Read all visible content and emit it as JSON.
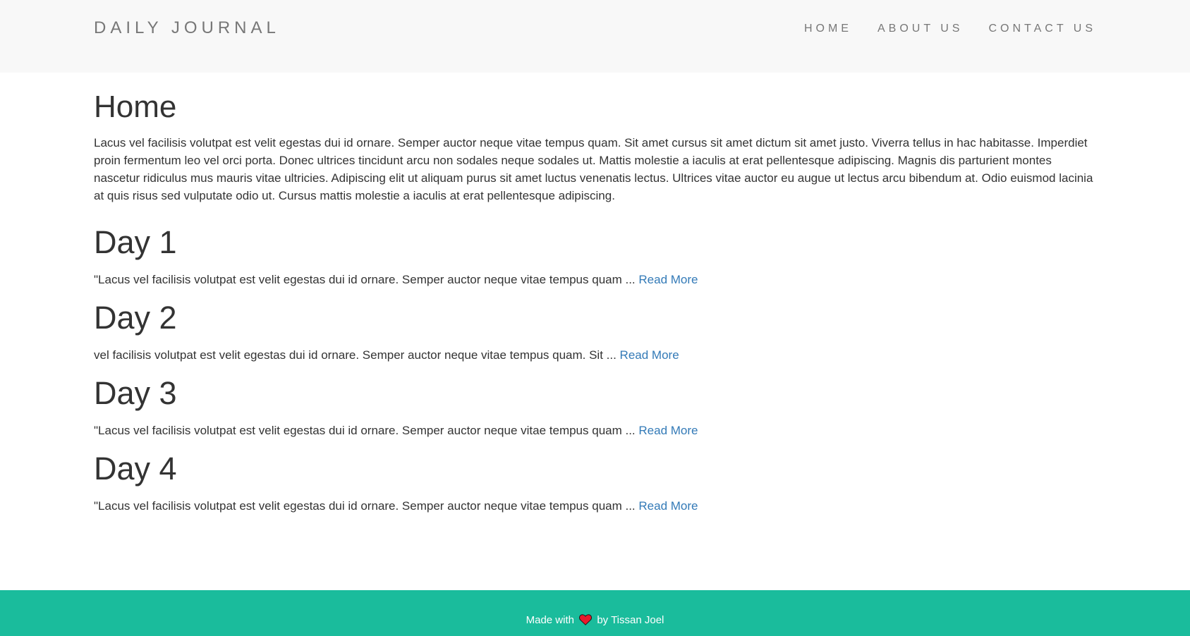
{
  "header": {
    "brand": "DAILY JOURNAL",
    "nav": [
      {
        "label": "HOME"
      },
      {
        "label": "ABOUT US"
      },
      {
        "label": "CONTACT US"
      }
    ]
  },
  "main": {
    "title": "Home",
    "intro": "Lacus vel facilisis volutpat est velit egestas dui id ornare. Semper auctor neque vitae tempus quam. Sit amet cursus sit amet dictum sit amet justo. Viverra tellus in hac habitasse. Imperdiet proin fermentum leo vel orci porta. Donec ultrices tincidunt arcu non sodales neque sodales ut. Mattis molestie a iaculis at erat pellentesque adipiscing. Magnis dis parturient montes nascetur ridiculus mus mauris vitae ultricies. Adipiscing elit ut aliquam purus sit amet luctus venenatis lectus. Ultrices vitae auctor eu augue ut lectus arcu bibendum at. Odio euismod lacinia at quis risus sed vulputate odio ut. Cursus mattis molestie a iaculis at erat pellentesque adipiscing.",
    "posts": [
      {
        "title": "Day 1",
        "excerpt": "\"Lacus vel facilisis volutpat est velit egestas dui id ornare. Semper auctor neque vitae tempus quam ... ",
        "read_more": "Read More"
      },
      {
        "title": "Day 2",
        "excerpt": "vel facilisis volutpat est velit egestas dui id ornare. Semper auctor neque vitae tempus quam. Sit ... ",
        "read_more": "Read More"
      },
      {
        "title": "Day 3",
        "excerpt": "\"Lacus vel facilisis volutpat est velit egestas dui id ornare. Semper auctor neque vitae tempus quam ... ",
        "read_more": "Read More"
      },
      {
        "title": "Day 4",
        "excerpt": "\"Lacus vel facilisis volutpat est velit egestas dui id ornare. Semper auctor neque vitae tempus quam ... ",
        "read_more": "Read More"
      }
    ]
  },
  "footer": {
    "prefix": "Made with",
    "icon": "heart-icon",
    "suffix": "by Tissan Joel"
  },
  "colors": {
    "navbar_bg": "#f8f8f8",
    "link": "#337ab7",
    "footer_bg": "#1abc9c",
    "heart": "#e8192c"
  }
}
